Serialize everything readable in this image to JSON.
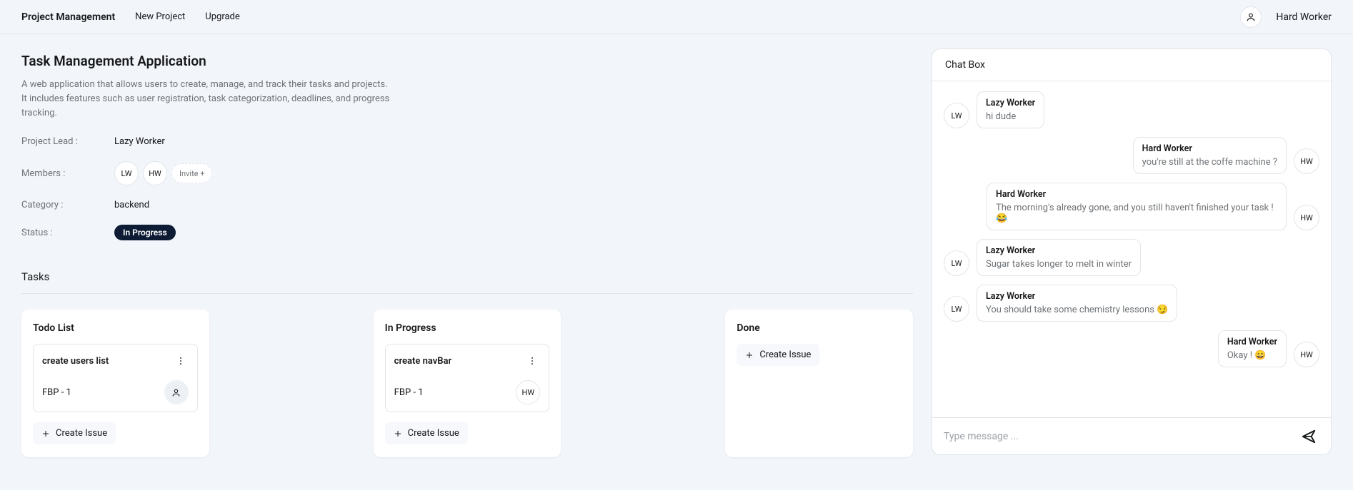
{
  "header": {
    "brand": "Project Management",
    "new_project": "New Project",
    "upgrade": "Upgrade",
    "user_name": "Hard Worker"
  },
  "project": {
    "title": "Task Management Application",
    "description": "A web application that allows users to create, manage, and track their tasks and projects. It includes features such as user registration, task categorization, deadlines, and progress tracking.",
    "lead_label": "Project Lead :",
    "lead_value": "Lazy Worker",
    "members_label": "Members :",
    "members": [
      {
        "initials": "LW"
      },
      {
        "initials": "HW"
      }
    ],
    "invite_label": "Invite +",
    "category_label": "Category :",
    "category_value": "backend",
    "status_label": "Status :",
    "status_value": "In Progress"
  },
  "tasks": {
    "heading": "Tasks",
    "create_label": "Create Issue",
    "columns": [
      {
        "title": "Todo List",
        "cards": [
          {
            "title": "create users list",
            "code": "FBP - 1",
            "assignee_type": "icon"
          }
        ]
      },
      {
        "title": "In Progress",
        "cards": [
          {
            "title": "create navBar",
            "code": "FBP - 1",
            "assignee_type": "initials",
            "assignee": "HW"
          }
        ]
      },
      {
        "title": "Done",
        "cards": []
      }
    ]
  },
  "chat": {
    "title": "Chat Box",
    "input_placeholder": "Type message ...",
    "messages": [
      {
        "side": "left",
        "initials": "LW",
        "sender": "Lazy Worker",
        "text": "hi dude"
      },
      {
        "side": "right",
        "initials": "HW",
        "sender": "Hard Worker",
        "text": "you're still at the coffe machine ?"
      },
      {
        "side": "right",
        "initials": "HW",
        "sender": "Hard Worker",
        "text": "The morning's already gone, and you still haven't finished your task ! 😂"
      },
      {
        "side": "left",
        "initials": "LW",
        "sender": "Lazy Worker",
        "text": "Sugar takes longer to melt in winter"
      },
      {
        "side": "left",
        "initials": "LW",
        "sender": "Lazy Worker",
        "text": "You should take some chemistry lessons 😏"
      },
      {
        "side": "right",
        "initials": "HW",
        "sender": "Hard Worker",
        "text": "Okay ! 😄"
      }
    ]
  }
}
